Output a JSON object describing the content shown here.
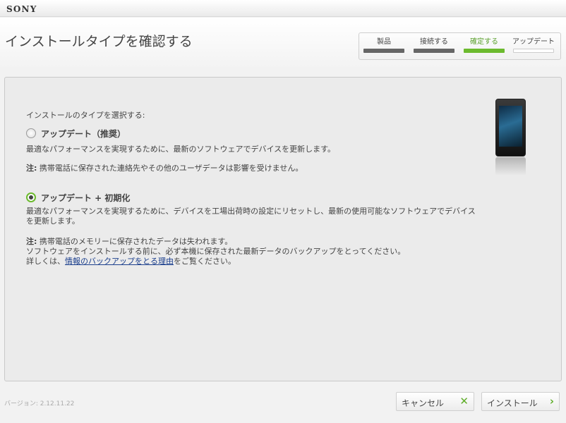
{
  "brand": "SONY",
  "header": {
    "title": "インストールタイプを確認する"
  },
  "steps": [
    {
      "label": "製品",
      "state": "done"
    },
    {
      "label": "接続する",
      "state": "done"
    },
    {
      "label": "確定する",
      "state": "active"
    },
    {
      "label": "アップデート",
      "state": "pending"
    }
  ],
  "main": {
    "prompt": "インストールのタイプを選択する:",
    "option_update": {
      "label": "アップデート（推奨）",
      "selected": false,
      "description": "最適なパフォーマンスを実現するために、最新のソフトウェアでデバイスを更新します。",
      "note_label": "注:",
      "note_text": "携帯電話に保存された連絡先やその他のユーザデータは影響を受けません。"
    },
    "option_update_reset": {
      "label": "アップデート + 初期化",
      "selected": true,
      "description": "最適なパフォーマンスを実現するために、デバイスを工場出荷時の設定にリセットし、最新の使用可能なソフトウェアでデバイスを更新します。",
      "note_label": "注:",
      "note_text": "携帯電話のメモリーに保存されたデータは失われます。",
      "warning": "ソフトウェアをインストールする前に、必ず本機に保存された最新データのバックアップをとってください。",
      "details_prefix": "詳しくは、",
      "details_link": "情報のバックアップをとる理由",
      "details_suffix": "をご覧ください。"
    },
    "device_image": "phone-image"
  },
  "footer": {
    "version": "バージョン: 2.12.11.22",
    "cancel_label": "キャンセル",
    "cancel_icon": "close-icon",
    "install_label": "インストール",
    "install_icon": "chevron-right-icon"
  },
  "colors": {
    "accent": "#6cba2e",
    "link": "#1a3e8c"
  }
}
